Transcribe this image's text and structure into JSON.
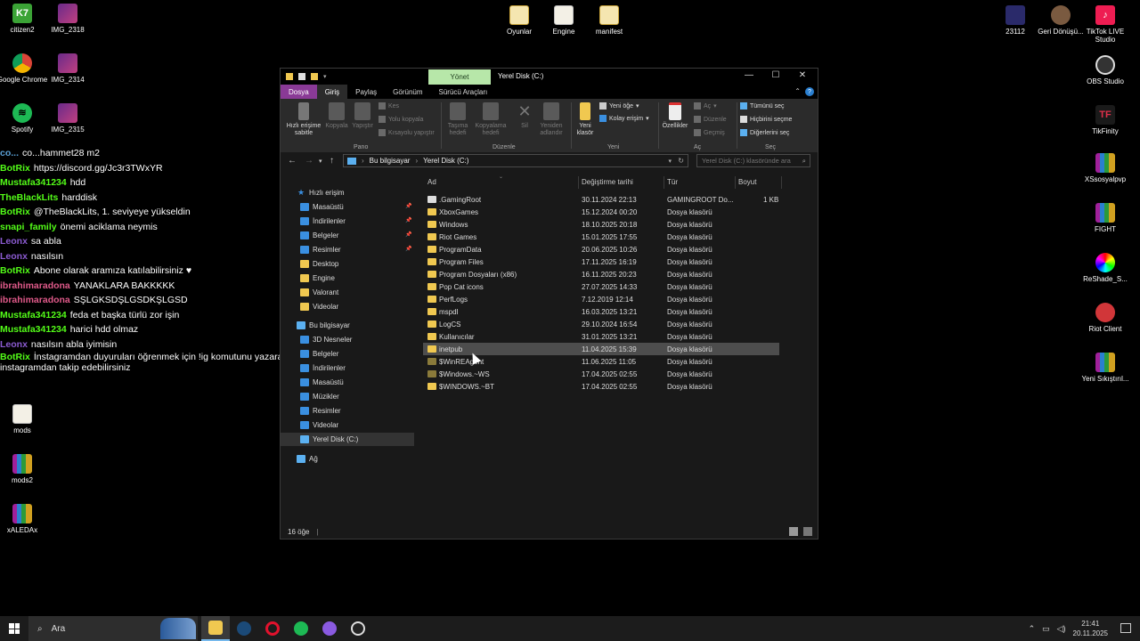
{
  "desktop": {
    "icons_left": [
      {
        "label": "citizen2",
        "badge": "K7"
      },
      {
        "label": "IMG_2318"
      },
      {
        "label": "Google Chrome"
      },
      {
        "label": "IMG_2314"
      },
      {
        "label": "Spotify"
      },
      {
        "label": "IMG_2315"
      },
      {
        "label": "mods"
      },
      {
        "label": "mods2"
      },
      {
        "label": "xALEDAx"
      }
    ],
    "icons_top": [
      {
        "label": "Oyunlar"
      },
      {
        "label": "Engine"
      },
      {
        "label": "manifest"
      }
    ],
    "icons_right": [
      {
        "label": "23112"
      },
      {
        "label": "Geri Dönüşü..."
      },
      {
        "label": "TikTok LIVE Studio"
      },
      {
        "label": "OBS Studio"
      },
      {
        "label": "TikFinity"
      },
      {
        "label": "XSsosyalpvp"
      },
      {
        "label": "FIGHT"
      },
      {
        "label": "ReShade_S..."
      },
      {
        "label": "Riot Client"
      },
      {
        "label": "Yeni Sıkıştırıl..."
      }
    ]
  },
  "chat": [
    {
      "name": "co...",
      "text": "co...hammet28 m2",
      "color": "#5a9fd4"
    },
    {
      "name": "BotRix",
      "text": "https://discord.gg/Jc3r3TWxYR",
      "color": "#53fc18"
    },
    {
      "name": "Mustafa341234",
      "text": "hdd",
      "color": "#53fc18"
    },
    {
      "name": "TheBlackLits",
      "text": "harddisk",
      "color": "#53fc18"
    },
    {
      "name": "BotRix",
      "text": "@TheBlackLits, 1. seviyeye yükseldin",
      "color": "#53fc18"
    },
    {
      "name": "snapi_family",
      "text": "önemi aciklama neymis",
      "color": "#53fc18"
    },
    {
      "name": "Leonx",
      "text": "sa abla",
      "color": "#8a5acf"
    },
    {
      "name": "Leonx",
      "text": "nasılsın",
      "color": "#8a5acf"
    },
    {
      "name": "BotRix",
      "text": "Abone olarak aramıza katılabilirsiniz ♥",
      "color": "#53fc18"
    },
    {
      "name": "ibrahimaradona",
      "text": "YANAKLARA BAKKKKK",
      "color": "#e05a8a"
    },
    {
      "name": "ibrahimaradona",
      "text": "SŞLGKSDŞLGSDKŞLGSD",
      "color": "#e05a8a"
    },
    {
      "name": "Mustafa341234",
      "text": "feda et başka türlü zor işin",
      "color": "#53fc18"
    },
    {
      "name": "Mustafa341234",
      "text": "harici hdd olmaz",
      "color": "#53fc18"
    },
    {
      "name": "Leonx",
      "text": "nasılsın abla iyimisin",
      "color": "#8a5acf"
    },
    {
      "name": "BotRix",
      "text": "İnstagramdan duyuruları öğrenmek için !ig komutunu yazarak instagramdan takip edebilirsiniz",
      "color": "#53fc18"
    }
  ],
  "explorer": {
    "manage_tab": "Yönet",
    "title": "Yerel Disk (C:)",
    "tabs": [
      "Dosya",
      "Giriş",
      "Paylaş",
      "Görünüm",
      "Sürücü Araçları"
    ],
    "ribbon": {
      "pin": "Hızlı erişime sabitle",
      "copy": "Kopyala",
      "paste": "Yapıştır",
      "cut": "Kes",
      "copy_path": "Yolu kopyala",
      "paste_shortcut": "Kısayolu yapıştır",
      "group_clipboard": "Pano",
      "move_to": "Taşıma hedefi",
      "copy_to": "Kopyalama hedefi",
      "delete": "Sil",
      "rename": "Yeniden adlandır",
      "group_organize": "Düzenle",
      "new_folder": "Yeni klasör",
      "new_item": "Yeni öğe",
      "easy_access": "Kolay erişim",
      "group_new": "Yeni",
      "properties": "Özellikler",
      "open": "Aç",
      "edit": "Düzenle",
      "history": "Geçmiş",
      "group_open": "Aç",
      "select_all": "Tümünü seç",
      "select_none": "Hiçbirini seçme",
      "invert_selection": "Diğerlerini seç",
      "group_select": "Seç"
    },
    "address": {
      "crumb1": "Bu bilgisayar",
      "crumb2": "Yerel Disk (C:)",
      "search_placeholder": "Yerel Disk (C:) klasöründe ara"
    },
    "nav": {
      "quick_access": "Hızlı erişim",
      "quick": [
        "Masaüstü",
        "İndirilenler",
        "Belgeler",
        "Resimler",
        "Desktop",
        "Engine",
        "Valorant",
        "Videolar"
      ],
      "this_pc": "Bu bilgisayar",
      "pc": [
        "3D Nesneler",
        "Belgeler",
        "İndirilenler",
        "Masaüstü",
        "Müzikler",
        "Resimler",
        "Videolar",
        "Yerel Disk (C:)"
      ],
      "network": "Ağ"
    },
    "columns": {
      "name": "Ad",
      "date": "Değiştirme tarihi",
      "type": "Tür",
      "size": "Boyut"
    },
    "files": [
      {
        "name": ".GamingRoot",
        "date": "30.11.2024 22:13",
        "type": "GAMINGROOT Do...",
        "size": "1 KB"
      },
      {
        "name": "XboxGames",
        "date": "15.12.2024 00:20",
        "type": "Dosya klasörü",
        "size": ""
      },
      {
        "name": "Windows",
        "date": "18.10.2025 20:18",
        "type": "Dosya klasörü",
        "size": ""
      },
      {
        "name": "Riot Games",
        "date": "15.01.2025 17:55",
        "type": "Dosya klasörü",
        "size": ""
      },
      {
        "name": "ProgramData",
        "date": "20.06.2025 10:26",
        "type": "Dosya klasörü",
        "size": ""
      },
      {
        "name": "Program Files",
        "date": "17.11.2025 16:19",
        "type": "Dosya klasörü",
        "size": ""
      },
      {
        "name": "Program Dosyaları (x86)",
        "date": "16.11.2025 20:23",
        "type": "Dosya klasörü",
        "size": ""
      },
      {
        "name": "Pop Cat icons",
        "date": "27.07.2025 14:33",
        "type": "Dosya klasörü",
        "size": ""
      },
      {
        "name": "PerfLogs",
        "date": "7.12.2019 12:14",
        "type": "Dosya klasörü",
        "size": ""
      },
      {
        "name": "mspdl",
        "date": "16.03.2025 13:21",
        "type": "Dosya klasörü",
        "size": ""
      },
      {
        "name": "LogCS",
        "date": "29.10.2024 16:54",
        "type": "Dosya klasörü",
        "size": ""
      },
      {
        "name": "Kullanıcılar",
        "date": "31.01.2025 13:21",
        "type": "Dosya klasörü",
        "size": ""
      },
      {
        "name": "inetpub",
        "date": "11.04.2025 15:39",
        "type": "Dosya klasörü",
        "size": ""
      },
      {
        "name": "$WinREAgent",
        "date": "11.06.2025 11:05",
        "type": "Dosya klasörü",
        "size": ""
      },
      {
        "name": "$Windows.~WS",
        "date": "17.04.2025 02:55",
        "type": "Dosya klasörü",
        "size": ""
      },
      {
        "name": "$WINDOWS.~BT",
        "date": "17.04.2025 02:55",
        "type": "Dosya klasörü",
        "size": ""
      }
    ],
    "status": "16 öğe"
  },
  "taskbar": {
    "search_label": "Ara",
    "time": "21:41",
    "date": "20.11.2025"
  },
  "colors": {
    "accent": "#76b9ed",
    "file_tab": "#8a3a96",
    "manage_tab": "#b7e7a9",
    "folder": "#f0c850"
  }
}
